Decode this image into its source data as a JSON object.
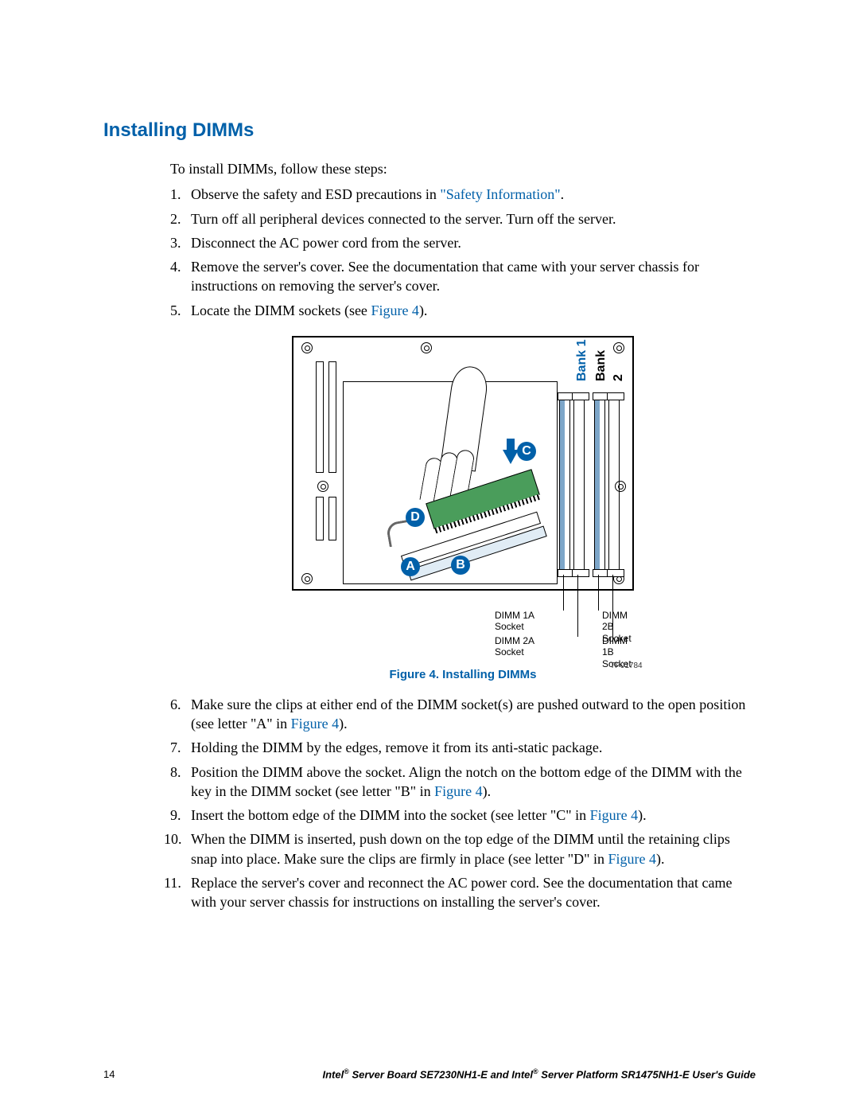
{
  "heading": "Installing DIMMs",
  "intro": "To install DIMMs, follow these steps:",
  "steps_a": [
    {
      "pre": "Observe the safety and ESD precautions in ",
      "link": "\"Safety Information\"",
      "post": "."
    },
    {
      "pre": "Turn off all peripheral devices connected to the server. Turn off the server."
    },
    {
      "pre": "Disconnect the AC power cord from the server."
    },
    {
      "pre": "Remove the server's cover. See the documentation that came with your server chassis for instructions on removing the server's cover."
    },
    {
      "pre": "Locate the DIMM sockets (see ",
      "link": "Figure 4",
      "post": ")."
    }
  ],
  "figure": {
    "bank1": "Bank 1",
    "bank2": "Bank 2",
    "bubbles": {
      "A": "A",
      "B": "B",
      "C": "C",
      "D": "D"
    },
    "sockets": {
      "s1a_l1": "DIMM 1A",
      "s1a_l2": "Socket",
      "s2a_l1": "DIMM 2A",
      "s2a_l2": "Socket",
      "s2b_l1": "DIMM 2B",
      "s2b_l2": "Socket",
      "s1b_l1": "DIMM 1B",
      "s1b_l2": "Socket"
    },
    "tp": "TP01784",
    "caption": "Figure 4. Installing DIMMs"
  },
  "steps_b": [
    {
      "pre": "Make sure the clips at either end of the DIMM socket(s) are pushed outward to the open position (see letter \"A\" in ",
      "link": "Figure 4",
      "post": ")."
    },
    {
      "pre": "Holding the DIMM by the edges, remove it from its anti-static package."
    },
    {
      "pre": "Position the DIMM above the socket. Align the notch on the bottom edge of the DIMM with the key in the DIMM socket (see letter \"B\" in ",
      "link": "Figure 4",
      "post": ")."
    },
    {
      "pre": "Insert the bottom edge of the DIMM into the socket (see letter \"C\" in ",
      "link": "Figure 4",
      "post": ")."
    },
    {
      "pre": "When the DIMM is inserted, push down on the top edge of the DIMM until the retaining clips snap into place. Make sure the clips are firmly in place (see letter \"D\" in ",
      "link": "Figure 4",
      "post": ")."
    },
    {
      "pre": "Replace the server's cover and reconnect the AC power cord. See the documentation that came with your server chassis for instructions on installing the server's cover."
    }
  ],
  "footer": {
    "page": "14",
    "title_pre": "Intel",
    "title_mid": " Server Board SE7230NH1-E and Intel",
    "title_post": " Server Platform SR1475NH1-E User's Guide",
    "reg": "®"
  }
}
